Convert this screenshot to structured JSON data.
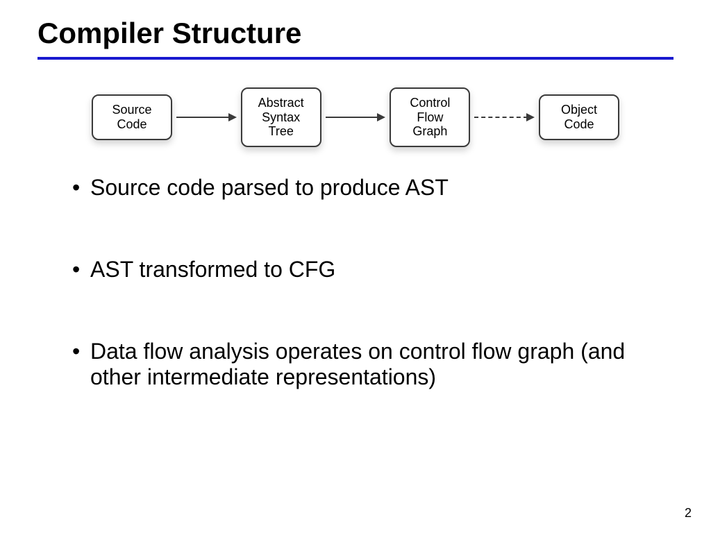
{
  "title": "Compiler Structure",
  "diagram": {
    "boxes": [
      "Source\nCode",
      "Abstract\nSyntax\nTree",
      "Control\nFlow\nGraph",
      "Object\nCode"
    ],
    "arrows": [
      {
        "dashed": false
      },
      {
        "dashed": false
      },
      {
        "dashed": true
      }
    ]
  },
  "bullets": [
    "Source code parsed to produce AST",
    "AST transformed to CFG",
    "Data flow analysis operates on control flow graph (and other intermediate representations)"
  ],
  "page_number": "2"
}
